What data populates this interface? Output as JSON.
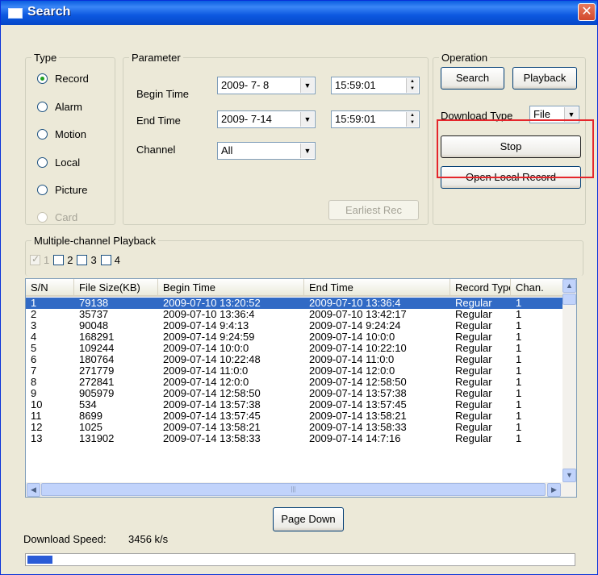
{
  "window": {
    "title": "Search",
    "close_icon": "close-icon"
  },
  "type_group": {
    "legend": "Type",
    "options": [
      {
        "label": "Record",
        "checked": true,
        "disabled": false
      },
      {
        "label": "Alarm",
        "checked": false,
        "disabled": false
      },
      {
        "label": "Motion",
        "checked": false,
        "disabled": false
      },
      {
        "label": "Local",
        "checked": false,
        "disabled": false
      },
      {
        "label": "Picture",
        "checked": false,
        "disabled": false
      },
      {
        "label": "Card",
        "checked": false,
        "disabled": true
      }
    ]
  },
  "parameter_group": {
    "legend": "Parameter",
    "begin_time_label": "Begin Time",
    "begin_date": "2009- 7- 8",
    "begin_time": "15:59:01",
    "end_time_label": "End Time",
    "end_date": "2009- 7-14",
    "end_time": "15:59:01",
    "channel_label": "Channel",
    "channel_value": "All",
    "earliest_rec_button": "Earliest Rec"
  },
  "operation_group": {
    "legend": "Operation",
    "search_button": "Search",
    "playback_button": "Playback",
    "download_type_label": "Download Type",
    "download_type_value": "File",
    "stop_button": "Stop",
    "open_local_record_button": "Open Local Record"
  },
  "multichannel_group": {
    "legend": "Multiple-channel Playback",
    "channels": [
      "1",
      "2",
      "3",
      "4"
    ]
  },
  "table": {
    "columns": [
      "S/N",
      "File Size(KB)",
      "Begin Time",
      "End Time",
      "Record Type",
      "Chan."
    ],
    "rows": [
      [
        "1",
        "79138",
        "2009-07-10 13:20:52",
        "2009-07-10 13:36:4",
        "Regular",
        "1"
      ],
      [
        "2",
        "35737",
        "2009-07-10 13:36:4",
        "2009-07-10 13:42:17",
        "Regular",
        "1"
      ],
      [
        "3",
        "90048",
        "2009-07-14 9:4:13",
        "2009-07-14 9:24:24",
        "Regular",
        "1"
      ],
      [
        "4",
        "168291",
        "2009-07-14 9:24:59",
        "2009-07-14 10:0:0",
        "Regular",
        "1"
      ],
      [
        "5",
        "109244",
        "2009-07-14 10:0:0",
        "2009-07-14 10:22:10",
        "Regular",
        "1"
      ],
      [
        "6",
        "180764",
        "2009-07-14 10:22:48",
        "2009-07-14 11:0:0",
        "Regular",
        "1"
      ],
      [
        "7",
        "271779",
        "2009-07-14 11:0:0",
        "2009-07-14 12:0:0",
        "Regular",
        "1"
      ],
      [
        "8",
        "272841",
        "2009-07-14 12:0:0",
        "2009-07-14 12:58:50",
        "Regular",
        "1"
      ],
      [
        "9",
        "905979",
        "2009-07-14 12:58:50",
        "2009-07-14 13:57:38",
        "Regular",
        "1"
      ],
      [
        "10",
        "534",
        "2009-07-14 13:57:38",
        "2009-07-14 13:57:45",
        "Regular",
        "1"
      ],
      [
        "11",
        "8699",
        "2009-07-14 13:57:45",
        "2009-07-14 13:58:21",
        "Regular",
        "1"
      ],
      [
        "12",
        "1025",
        "2009-07-14 13:58:21",
        "2009-07-14 13:58:33",
        "Regular",
        "1"
      ],
      [
        "13",
        "131902",
        "2009-07-14 13:58:33",
        "2009-07-14 14:7:16",
        "Regular",
        "1"
      ]
    ],
    "selected_row": 0
  },
  "page_down_button": "Page Down",
  "download_speed_label": "Download Speed:",
  "download_speed_value": "3456 k/s",
  "download_progress": 0.045,
  "colors": {
    "selection": "#316ac5",
    "highlight_box": "#e5262b",
    "titlebar": "#0a5de0"
  }
}
